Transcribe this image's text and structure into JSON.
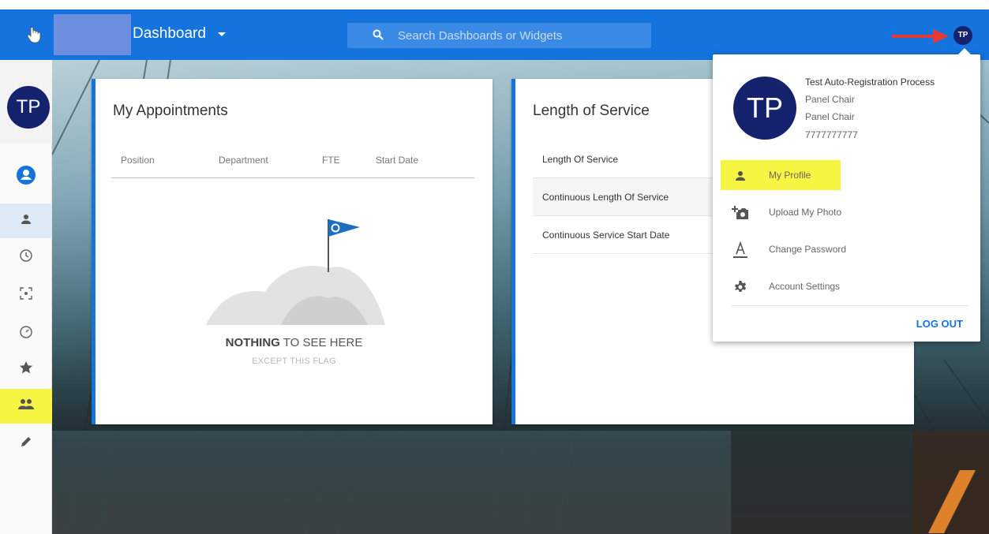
{
  "topbar": {
    "title": "Dashboard",
    "search_placeholder": "Search Dashboards or Widgets",
    "avatar_initials": "TP",
    "colors": {
      "bar": "#1473dc",
      "avatar": "#15226e",
      "arrow": "#e53935"
    }
  },
  "sidebar": {
    "avatar_initials": "TP",
    "items": [
      {
        "icon": "account-circle-icon"
      },
      {
        "icon": "person-icon"
      },
      {
        "icon": "clock-icon"
      },
      {
        "icon": "focus-icon"
      },
      {
        "icon": "timer-icon"
      },
      {
        "icon": "star-icon"
      },
      {
        "icon": "people-icon"
      },
      {
        "icon": "pencil-icon"
      }
    ]
  },
  "appointments": {
    "title": "My Appointments",
    "columns": [
      "Position",
      "Department",
      "FTE",
      "Start Date"
    ],
    "empty_title_bold": "NOTHING",
    "empty_title_rest": " TO SEE HERE",
    "empty_sub": "EXCEPT THIS FLAG"
  },
  "service": {
    "title": "Length of Service",
    "rows": [
      "Length Of Service",
      "Continuous Length Of Service",
      "Continuous Service Start Date"
    ]
  },
  "profile_menu": {
    "initials": "TP",
    "name": "Test Auto-Registration Process",
    "role1": "Panel Chair",
    "role2": "Panel Chair",
    "phone": "7777777777",
    "items": [
      {
        "label": "My Profile",
        "icon": "person-icon"
      },
      {
        "label": "Upload My Photo",
        "icon": "add-photo-icon"
      },
      {
        "label": "Change Password",
        "icon": "text-format-icon"
      },
      {
        "label": "Account Settings",
        "icon": "gear-icon"
      }
    ],
    "logout": "LOG OUT",
    "highlight": "#f5f542"
  }
}
